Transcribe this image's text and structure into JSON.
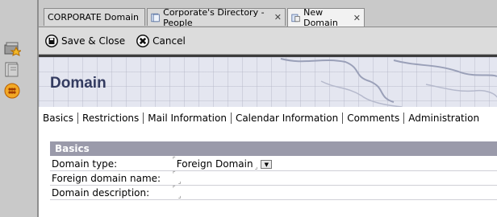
{
  "tabs": [
    {
      "label": "CORPORATE Domain",
      "icon": "none",
      "closable": false,
      "active": false
    },
    {
      "label": "Corporate's Directory - People",
      "icon": "directory-icon",
      "closable": true,
      "active": false
    },
    {
      "label": "New Domain",
      "icon": "new-domain-icon",
      "closable": true,
      "active": true
    }
  ],
  "actions": {
    "save_close": "Save & Close",
    "cancel": "Cancel"
  },
  "banner": {
    "title": "Domain"
  },
  "doc_tabs": [
    "Basics",
    "Restrictions",
    "Mail Information",
    "Calendar Information",
    "Comments",
    "Administration"
  ],
  "section": {
    "title": "Basics"
  },
  "fields": [
    {
      "label": "Domain type:",
      "value": "Foreign Domain",
      "has_dropdown": true
    },
    {
      "label": "Foreign domain name:",
      "value": "",
      "has_dropdown": false
    },
    {
      "label": "Domain description:",
      "value": "",
      "has_dropdown": false
    }
  ],
  "colors": {
    "section_bar": "#9a9aaa",
    "banner_title": "#333b60",
    "chrome": "#c9c9c9"
  }
}
